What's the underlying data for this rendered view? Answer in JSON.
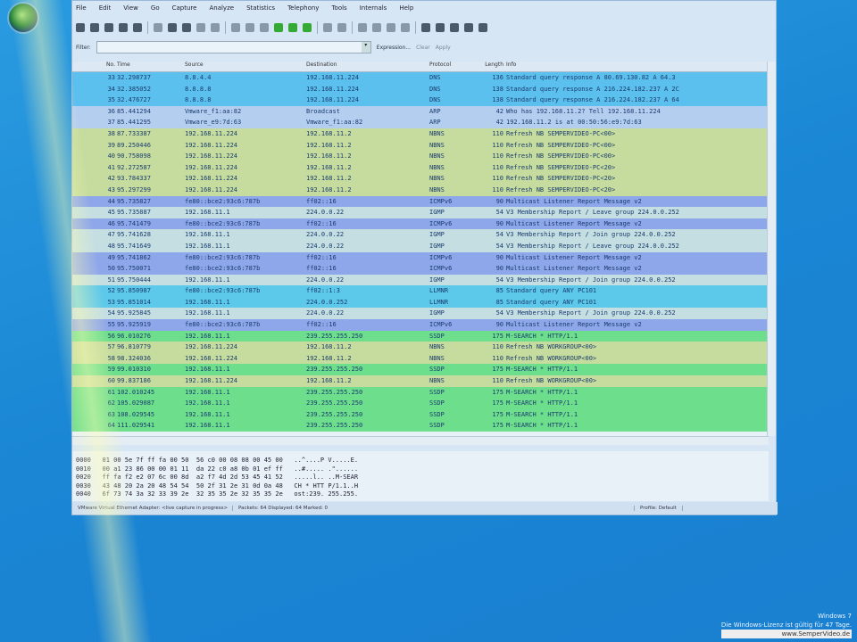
{
  "menu": [
    "File",
    "Edit",
    "View",
    "Go",
    "Capture",
    "Analyze",
    "Statistics",
    "Telephony",
    "Tools",
    "Internals",
    "Help"
  ],
  "filter": {
    "label": "Filter:",
    "value": "",
    "expression": "Expression...",
    "clear": "Clear",
    "apply": "Apply"
  },
  "columns": [
    "No.",
    "Time",
    "Source",
    "Destination",
    "Protocol",
    "Length",
    "Info"
  ],
  "colors": {
    "DNS": "#5cc0ee",
    "ARP": "#b4cef0",
    "NBNS": "#c6dc9e",
    "ICMPv6": "#8ea6ea",
    "IGMP": "#c4dee2",
    "LLMNR": "#5cc8ea",
    "SSDP": "#6cde8c"
  },
  "packets": [
    [
      "33",
      "32.298737",
      "8.8.4.4",
      "192.168.11.224",
      "DNS",
      "136",
      "Standard query response A 80.69.130.82 A 64.3"
    ],
    [
      "34",
      "32.385052",
      "8.8.8.8",
      "192.168.11.224",
      "DNS",
      "138",
      "Standard query response A 216.224.182.237 A 2C"
    ],
    [
      "35",
      "32.476727",
      "8.8.8.8",
      "192.168.11.224",
      "DNS",
      "138",
      "Standard query response A 216.224.182.237 A 64"
    ],
    [
      "36",
      "85.441294",
      "Vmware_f1:aa:82",
      "Broadcast",
      "ARP",
      "42",
      "Who has 192.168.11.2?  Tell 192.168.11.224"
    ],
    [
      "37",
      "85.441295",
      "Vmware_e9:7d:63",
      "Vmware_f1:aa:82",
      "ARP",
      "42",
      "192.168.11.2 is at 00:50:56:e9:7d:63"
    ],
    [
      "38",
      "87.733387",
      "192.168.11.224",
      "192.168.11.2",
      "NBNS",
      "110",
      "Refresh NB SEMPERVIDEO-PC<00>"
    ],
    [
      "39",
      "89.250446",
      "192.168.11.224",
      "192.168.11.2",
      "NBNS",
      "110",
      "Refresh NB SEMPERVIDEO-PC<00>"
    ],
    [
      "40",
      "90.758098",
      "192.168.11.224",
      "192.168.11.2",
      "NBNS",
      "110",
      "Refresh NB SEMPERVIDEO-PC<00>"
    ],
    [
      "41",
      "92.272587",
      "192.168.11.224",
      "192.168.11.2",
      "NBNS",
      "110",
      "Refresh NB SEMPERVIDEO-PC<20>"
    ],
    [
      "42",
      "93.784337",
      "192.168.11.224",
      "192.168.11.2",
      "NBNS",
      "110",
      "Refresh NB SEMPERVIDEO-PC<20>"
    ],
    [
      "43",
      "95.297299",
      "192.168.11.224",
      "192.168.11.2",
      "NBNS",
      "110",
      "Refresh NB SEMPERVIDEO-PC<20>"
    ],
    [
      "44",
      "95.735827",
      "fe80::bce2:93c6:787b",
      "ff02::16",
      "ICMPv6",
      "90",
      "Multicast Listener Report Message v2"
    ],
    [
      "45",
      "95.735887",
      "192.168.11.1",
      "224.0.0.22",
      "IGMP",
      "54",
      "V3 Membership Report / Leave group 224.0.0.252"
    ],
    [
      "46",
      "95.741479",
      "fe80::bce2:93c6:787b",
      "ff02::16",
      "ICMPv6",
      "90",
      "Multicast Listener Report Message v2"
    ],
    [
      "47",
      "95.741628",
      "192.168.11.1",
      "224.0.0.22",
      "IGMP",
      "54",
      "V3 Membership Report / Join group 224.0.0.252"
    ],
    [
      "48",
      "95.741649",
      "192.168.11.1",
      "224.0.0.22",
      "IGMP",
      "54",
      "V3 Membership Report / Leave group 224.0.0.252"
    ],
    [
      "49",
      "95.741862",
      "fe80::bce2:93c6:787b",
      "ff02::16",
      "ICMPv6",
      "90",
      "Multicast Listener Report Message v2"
    ],
    [
      "50",
      "95.750071",
      "fe80::bce2:93c6:787b",
      "ff02::16",
      "ICMPv6",
      "90",
      "Multicast Listener Report Message v2"
    ],
    [
      "51",
      "95.750444",
      "192.168.11.1",
      "224.0.0.22",
      "IGMP",
      "54",
      "V3 Membership Report / Join group 224.0.0.252"
    ],
    [
      "52",
      "95.850987",
      "fe80::bce2:93c6:787b",
      "ff02::1:3",
      "LLMNR",
      "85",
      "Standard query ANY PC101"
    ],
    [
      "53",
      "95.851014",
      "192.168.11.1",
      "224.0.0.252",
      "LLMNR",
      "85",
      "Standard query ANY PC101"
    ],
    [
      "54",
      "95.925845",
      "192.168.11.1",
      "224.0.0.22",
      "IGMP",
      "54",
      "V3 Membership Report / Join group 224.0.0.252"
    ],
    [
      "55",
      "95.925919",
      "fe80::bce2:93c6:787b",
      "ff02::16",
      "ICMPv6",
      "90",
      "Multicast Listener Report Message v2"
    ],
    [
      "56",
      "96.010276",
      "192.168.11.1",
      "239.255.255.250",
      "SSDP",
      "175",
      "M-SEARCH * HTTP/1.1"
    ],
    [
      "57",
      "96.810779",
      "192.168.11.224",
      "192.168.11.2",
      "NBNS",
      "110",
      "Refresh NB WORKGROUP<00>"
    ],
    [
      "58",
      "98.324036",
      "192.168.11.224",
      "192.168.11.2",
      "NBNS",
      "110",
      "Refresh NB WORKGROUP<00>"
    ],
    [
      "59",
      "99.010310",
      "192.168.11.1",
      "239.255.255.250",
      "SSDP",
      "175",
      "M-SEARCH * HTTP/1.1"
    ],
    [
      "60",
      "99.837186",
      "192.168.11.224",
      "192.168.11.2",
      "NBNS",
      "110",
      "Refresh NB WORKGROUP<00>"
    ],
    [
      "61",
      "102.010245",
      "192.168.11.1",
      "239.255.255.250",
      "SSDP",
      "175",
      "M-SEARCH * HTTP/1.1"
    ],
    [
      "62",
      "105.029087",
      "192.168.11.1",
      "239.255.255.250",
      "SSDP",
      "175",
      "M-SEARCH * HTTP/1.1"
    ],
    [
      "63",
      "108.029545",
      "192.168.11.1",
      "239.255.255.250",
      "SSDP",
      "175",
      "M-SEARCH * HTTP/1.1"
    ],
    [
      "64",
      "111.029541",
      "192.168.11.1",
      "239.255.255.250",
      "SSDP",
      "175",
      "M-SEARCH * HTTP/1.1"
    ]
  ],
  "hex": "0000   01 00 5e 7f ff fa 00 50  56 c0 00 08 08 00 45 00   ..^....P V.....E.\n0010   00 a1 23 86 00 00 01 11  da 22 c0 a8 0b 01 ef ff   ..#..... .\"......\n0020   ff fa f2 e2 07 6c 00 8d  a2 f7 4d 2d 53 45 41 52   .....l.. ..M-SEAR\n0030   43 48 20 2a 20 48 54 54  50 2f 31 2e 31 0d 0a 48   CH * HTT P/1.1..H\n0040   6f 73 74 3a 32 33 39 2e  32 35 35 2e 32 35 35 2e   ost:239. 255.255.",
  "status": {
    "iface": "VMware Virtual Ethernet Adapter: <live capture in progress>",
    "packets": "Packets: 64 Displayed: 64 Marked: 0",
    "profile": "Profile: Default"
  },
  "watermark": {
    "os": "Windows 7",
    "license": "Die Windows-Lizenz ist gültig für 47 Tage.",
    "site": "www.SemperVideo.de"
  }
}
